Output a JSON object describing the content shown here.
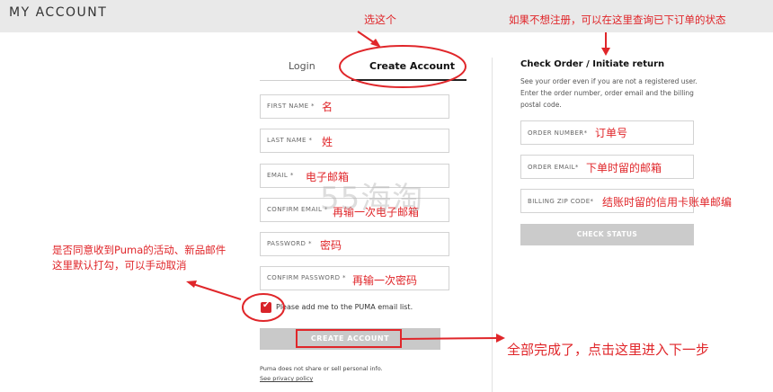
{
  "header": {
    "title": "MY ACCOUNT"
  },
  "tabs": {
    "login": "Login",
    "create": "Create Account"
  },
  "form": {
    "first_name": "FIRST NAME *",
    "last_name": "LAST NAME *",
    "email": "EMAIL *",
    "confirm_email": "CONFIRM EMAIL *",
    "password": "PASSWORD *",
    "confirm_password": "CONFIRM PASSWORD *",
    "email_optin": "Please add me to the PUMA email list.",
    "create_button": "CREATE ACCOUNT",
    "privacy_note": "Puma does not share or sell personal info.",
    "privacy_link": "See privacy policy"
  },
  "check_order": {
    "title": "Check Order / Initiate return",
    "description": "See your order even if you are not a registered user. Enter the order number, order email and the billing postal code.",
    "order_number": "ORDER NUMBER*",
    "order_email": "ORDER EMAIL*",
    "billing_zip": "BILLING ZIP CODE*",
    "check_button": "CHECK STATUS"
  },
  "annotations": {
    "select_this": "选这个",
    "guest_hint": "如果不想注册，可以在这里查询已下订单的状态",
    "first_name": "名",
    "last_name": "姓",
    "email": "电子邮箱",
    "confirm_email": "再输一次电子邮箱",
    "password": "密码",
    "confirm_password": "再输一次密码",
    "optin_line1": "是否同意收到Puma的活动、新品邮件",
    "optin_line2": "这里默认打勾，可以手动取消",
    "done": "全部完成了，点击这里进入下一步",
    "order_number": "订单号",
    "order_email": "下单时留的邮箱",
    "billing_zip": "结账时留的信用卡账单邮编"
  },
  "watermark": "55海淘",
  "colors": {
    "accent_red": "#e0262a",
    "checkbox": "#d8232a",
    "button_gray": "#c9c9c9",
    "header_bg": "#e9e9e9"
  }
}
